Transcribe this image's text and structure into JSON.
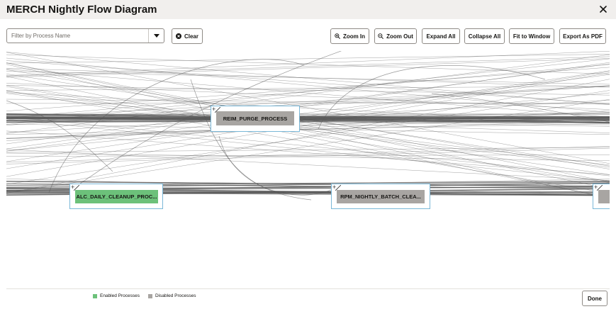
{
  "dialog": {
    "title": "MERCH Nightly Flow Diagram"
  },
  "toolbar": {
    "filter_placeholder": "Filter by Process Name",
    "clear_label": "Clear",
    "zoom_in_label": "Zoom In",
    "zoom_out_label": "Zoom Out",
    "expand_all_label": "Expand All",
    "collapse_all_label": "Collapse All",
    "fit_to_window_label": "Fit to Window",
    "export_pdf_label": "Export As PDF"
  },
  "nodes": [
    {
      "label": "REIM_PURGE_PROCESS",
      "status": "disabled"
    },
    {
      "label": "ALC_DAILY_CLEANUP_PROC...",
      "status": "enabled"
    },
    {
      "label": "RPM_NIGHTLY_BATCH_CLEA...",
      "status": "disabled"
    },
    {
      "label": "",
      "status": "disabled"
    }
  ],
  "legend": {
    "enabled_label": "Enabled Processes",
    "disabled_label": "Disabled Processes"
  },
  "footer": {
    "done_label": "Done"
  },
  "colors": {
    "enabled": "#6cc17a",
    "disabled": "#a8a5a2",
    "node_border": "#7ab8d8",
    "edge": "#555555"
  },
  "icons": {
    "close": "close-icon",
    "dropdown": "chevron-down-icon",
    "clear": "clear-x-icon",
    "zoom_in": "zoom-in-icon",
    "zoom_out": "zoom-out-icon",
    "expand": "plus-icon"
  }
}
